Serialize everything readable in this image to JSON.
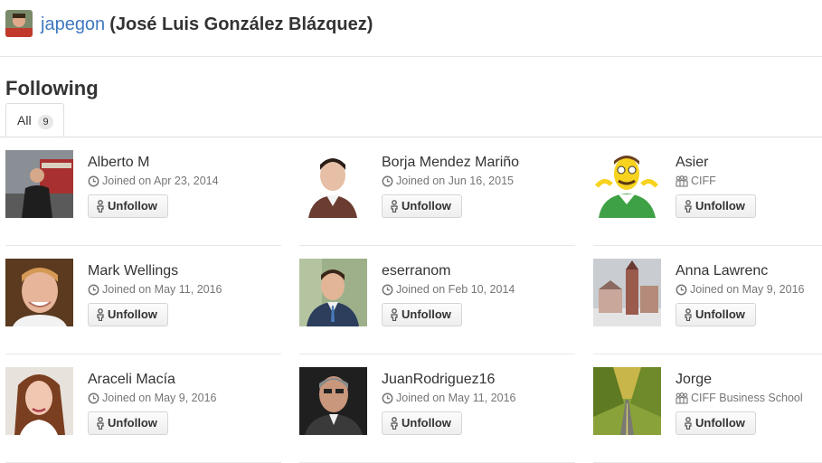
{
  "header": {
    "username": "japegon",
    "fullname": "(José Luis González Blázquez)"
  },
  "page": {
    "title": "Following",
    "tab_label": "All",
    "tab_count": "9",
    "unfollow_label": "Unfollow"
  },
  "users": [
    {
      "name": "Alberto M",
      "meta": "Joined on Apr 23, 2014",
      "meta_icon": "clock-icon"
    },
    {
      "name": "Borja Mendez Mariño",
      "meta": "Joined on Jun 16, 2015",
      "meta_icon": "clock-icon"
    },
    {
      "name": "Asier",
      "meta": "CIFF",
      "meta_icon": "organization-icon"
    },
    {
      "name": "Mark Wellings",
      "meta": "Joined on May 11, 2016",
      "meta_icon": "clock-icon"
    },
    {
      "name": "eserranom",
      "meta": "Joined on Feb 10, 2014",
      "meta_icon": "clock-icon"
    },
    {
      "name": "Anna Lawrenc",
      "meta": "Joined on May 9, 2016",
      "meta_icon": "clock-icon"
    },
    {
      "name": "Araceli Macía",
      "meta": "Joined on May 9, 2016",
      "meta_icon": "clock-icon"
    },
    {
      "name": "JuanRodriguez16",
      "meta": "Joined on May 11, 2016",
      "meta_icon": "clock-icon"
    },
    {
      "name": "Jorge",
      "meta": "CIFF Business School",
      "meta_icon": "organization-icon"
    }
  ],
  "colors": {
    "link": "#4078c0",
    "text": "#333333",
    "muted": "#767676",
    "border": "#e5e5e5"
  }
}
